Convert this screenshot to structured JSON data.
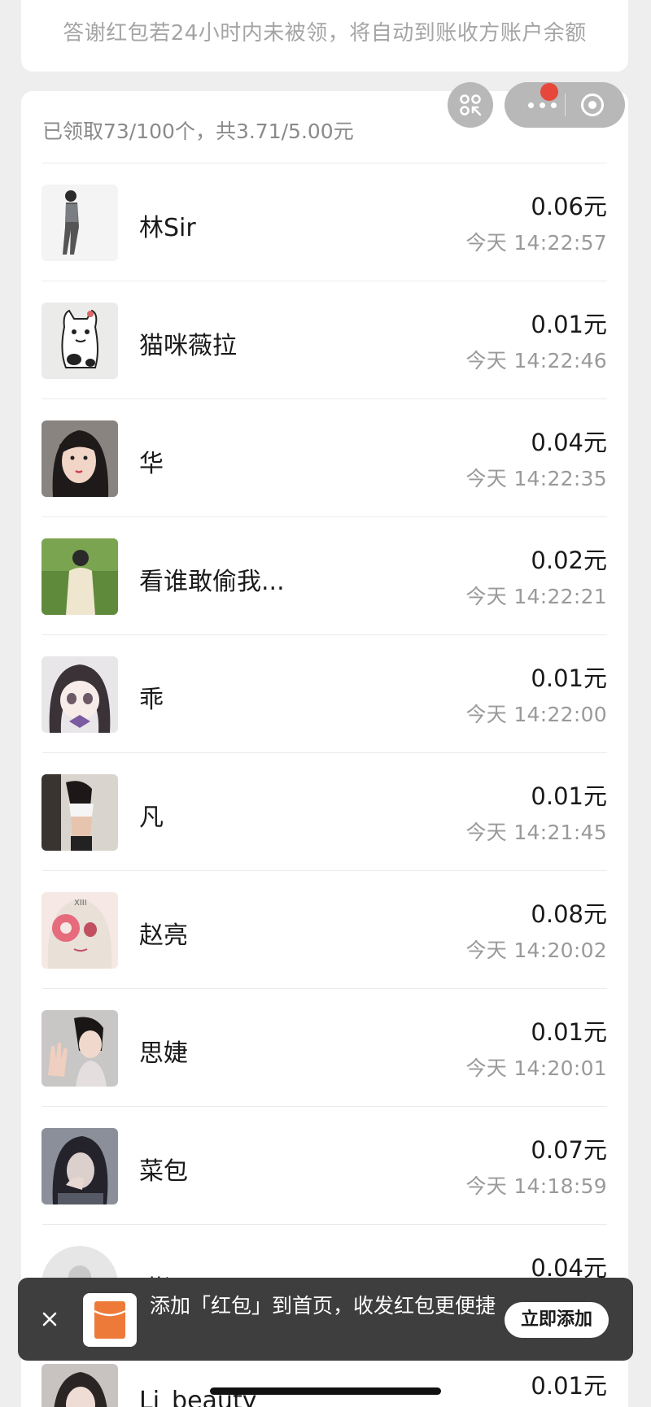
{
  "notice": {
    "text": "答谢红包若24小时内未被领，将自动到账收方账户余额"
  },
  "summary": {
    "text": "已领取73/100个，共3.71/5.00元"
  },
  "records": [
    {
      "name": "林Sir",
      "amount": "0.06元",
      "time": "今天 14:22:57",
      "avatar": "person-standing"
    },
    {
      "name": "猫咪薇拉",
      "amount": "0.01元",
      "time": "今天 14:22:46",
      "avatar": "cartoon-cat"
    },
    {
      "name": "华",
      "amount": "0.04元",
      "time": "今天 14:22:35",
      "avatar": "portrait-girl"
    },
    {
      "name": "看谁敢偷我...",
      "amount": "0.02元",
      "time": "今天 14:22:21",
      "avatar": "person-outdoor"
    },
    {
      "name": "乖",
      "amount": "0.01元",
      "time": "今天 14:22:00",
      "avatar": "anime-girl"
    },
    {
      "name": "凡",
      "amount": "0.01元",
      "time": "今天 14:21:45",
      "avatar": "mirror-selfie"
    },
    {
      "name": "赵亮",
      "amount": "0.08元",
      "time": "今天 14:20:02",
      "avatar": "anime-donut"
    },
    {
      "name": "思婕",
      "amount": "0.01元",
      "time": "今天 14:20:01",
      "avatar": "girl-waving"
    },
    {
      "name": "菜包",
      "amount": "0.07元",
      "time": "今天 14:18:59",
      "avatar": "dark-portrait"
    },
    {
      "name": "瑾汀",
      "amount": "0.04元",
      "time": "",
      "avatar": "default-avatar"
    },
    {
      "name": "Li_beauty",
      "amount": "0.01元",
      "time": "",
      "avatar": "portrait-girl-2"
    }
  ],
  "toast": {
    "message": "添加「红包」到首页，收发红包更便捷",
    "button_label": "立即添加"
  },
  "colors": {
    "page_bg": "#eeeeee",
    "card_bg": "#ffffff",
    "toast_bg": "#3e3e3e",
    "red_packet_orange": "#ee7a3a",
    "notification_red": "#e7463b"
  }
}
